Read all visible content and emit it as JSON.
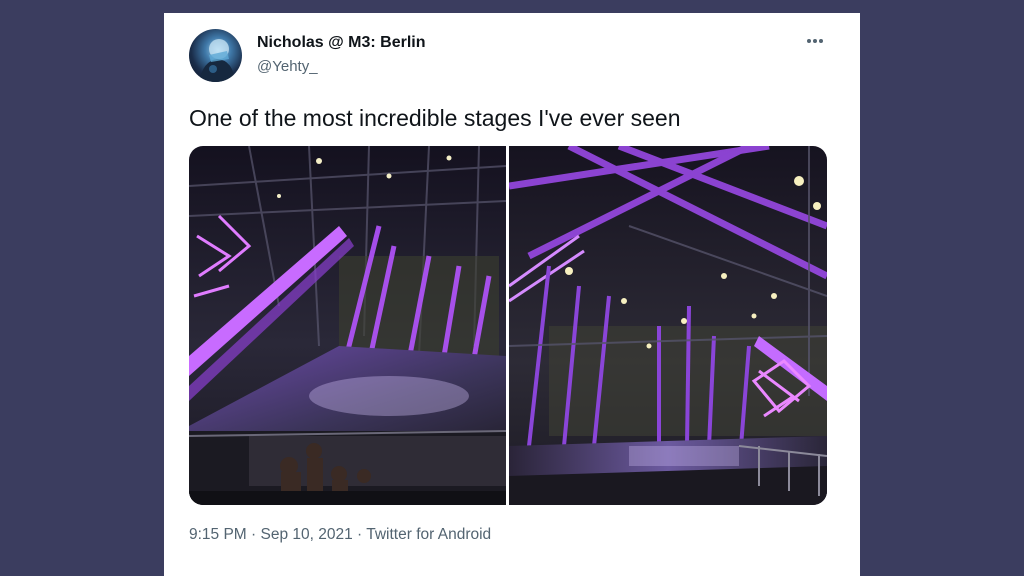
{
  "tweet": {
    "display_name": "Nicholas @ M3: Berlin",
    "handle": "@Yehty_",
    "text": "One of the most incredible stages I've ever seen",
    "time": "9:15 PM",
    "date": "Sep 10, 2021",
    "source": "Twitter for Android",
    "separator": " · ",
    "more_icon": "more-horizontal-icon",
    "avatar_icon": "user-avatar",
    "media": [
      {
        "alt": "stage-photo-left"
      },
      {
        "alt": "stage-photo-right"
      }
    ]
  },
  "colors": {
    "background": "#3b3d5f",
    "card": "#ffffff",
    "text_primary": "#0f1419",
    "text_secondary": "#536471",
    "stage_purple": "#b454ff"
  }
}
